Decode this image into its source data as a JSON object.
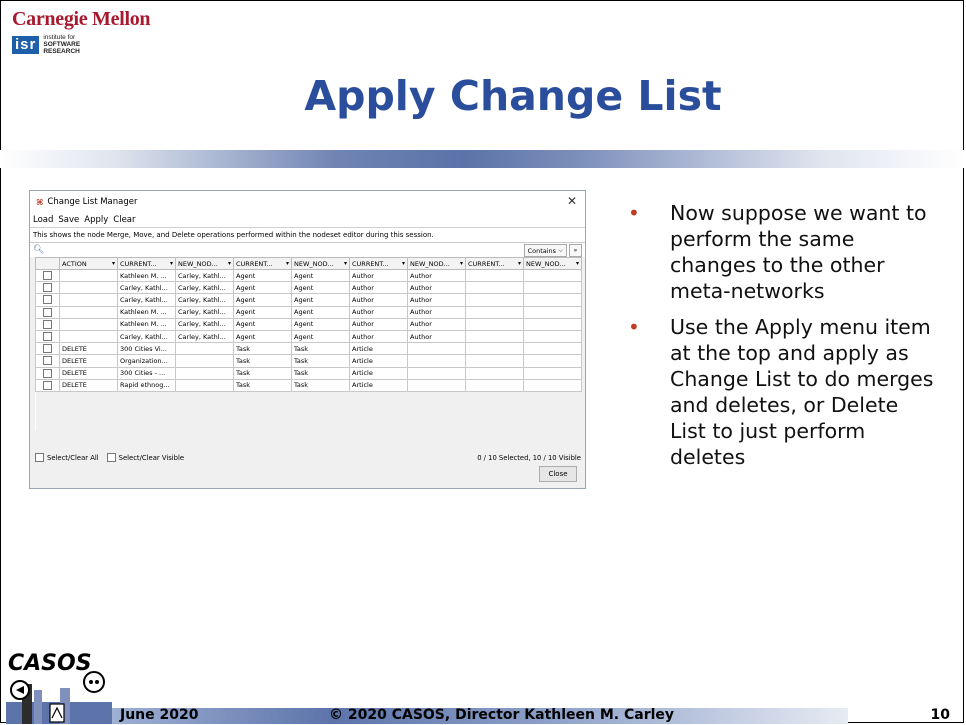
{
  "header": {
    "university": "Carnegie Mellon",
    "isr_abbrev": "isr",
    "isr_line1": "institute for",
    "isr_line2": "SOFTWARE",
    "isr_line3": "RESEARCH"
  },
  "slide": {
    "title": "Apply Change List",
    "bullets": [
      "Now suppose we want to perform the same changes to the other meta-networks",
      "Use the Apply menu item at the top and apply as Change List to do merges and deletes, or Delete List to just perform deletes"
    ]
  },
  "dialog": {
    "title": "Change List Manager",
    "icon": "network-icon",
    "menu": [
      "Load",
      "Save",
      "Apply",
      "Clear"
    ],
    "description": "This shows the node Merge, Move, and Delete operations performed within the nodeset editor during this session.",
    "search_mode": "Contains",
    "columns": [
      "",
      "ACTION",
      "CURRENT...",
      "NEW_NOD...",
      "CURRENT...",
      "NEW_NOD...",
      "CURRENT...",
      "NEW_NOD...",
      "CURRENT...",
      "NEW_NOD..."
    ],
    "rows": [
      [
        "",
        "Kathleen M. ...",
        "Carley, Kathl...",
        "Agent",
        "Agent",
        "Author",
        "Author",
        "",
        ""
      ],
      [
        "",
        "Carley, Kathl...",
        "Carley, Kathl...",
        "Agent",
        "Agent",
        "Author",
        "Author",
        "",
        ""
      ],
      [
        "",
        "Carley, Kathl...",
        "Carley, Kathl...",
        "Agent",
        "Agent",
        "Author",
        "Author",
        "",
        ""
      ],
      [
        "",
        "Kathleen M. ...",
        "Carley, Kathl...",
        "Agent",
        "Agent",
        "Author",
        "Author",
        "",
        ""
      ],
      [
        "",
        "Kathleen M. ...",
        "Carley, Kathl...",
        "Agent",
        "Agent",
        "Author",
        "Author",
        "",
        ""
      ],
      [
        "",
        "Carley, Kathl...",
        "Carley, Kathl...",
        "Agent",
        "Agent",
        "Author",
        "Author",
        "",
        ""
      ],
      [
        "DELETE",
        "300 Cities Vi...",
        "",
        "Task",
        "Task",
        "Article",
        "",
        "",
        ""
      ],
      [
        "DELETE",
        "Organization...",
        "",
        "Task",
        "Task",
        "Article",
        "",
        "",
        ""
      ],
      [
        "DELETE",
        "300 Cities - ...",
        "",
        "Task",
        "Task",
        "Article",
        "",
        "",
        ""
      ],
      [
        "DELETE",
        "Rapid ethnog...",
        "",
        "Task",
        "Task",
        "Article",
        "",
        "",
        ""
      ]
    ],
    "select_all": "Select/Clear All",
    "select_visible": "Select/Clear Visible",
    "count": "0 / 10 Selected, 10 / 10 Visible",
    "close": "Close"
  },
  "footer": {
    "logo_text": "CASOS",
    "date": "June 2020",
    "copyright": "© 2020 CASOS, Director Kathleen M. Carley",
    "page": "10"
  }
}
